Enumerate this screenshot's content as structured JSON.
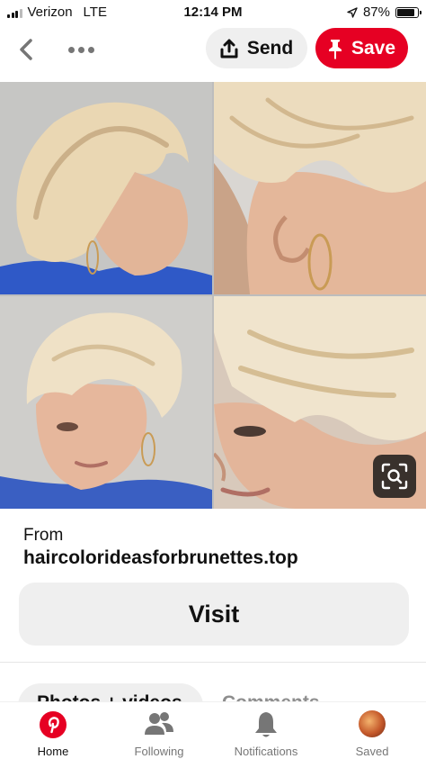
{
  "status_bar": {
    "carrier": "Verizon",
    "network": "LTE",
    "time": "12:14 PM",
    "battery": "87%",
    "battery_level": 0.87,
    "icons": [
      "signal-icon",
      "location-arrow-icon",
      "battery-icon"
    ]
  },
  "toolbar": {
    "send_label": "Send",
    "save_label": "Save",
    "icons": [
      "back-chevron-icon",
      "more-dots-icon",
      "share-upload-icon",
      "pushpin-icon"
    ],
    "save_color": "#e60023"
  },
  "pin": {
    "image_icon": "visual-search-lens-icon"
  },
  "source": {
    "from_label": "From",
    "domain": "haircolorideasforbrunettes.top"
  },
  "visit_label": "Visit",
  "tabs": {
    "photos_label": "Photos + videos",
    "comments_label": "Comments"
  },
  "bottom_nav": {
    "items": [
      {
        "label": "Home",
        "icon": "pinterest-logo-icon",
        "active": true
      },
      {
        "label": "Following",
        "icon": "people-icon",
        "active": false
      },
      {
        "label": "Notifications",
        "icon": "bell-icon",
        "active": false
      },
      {
        "label": "Saved",
        "icon": "avatar",
        "active": false
      }
    ]
  },
  "colors": {
    "brand": "#e60023",
    "button_gray": "#efefef",
    "muted_text": "#767676"
  }
}
